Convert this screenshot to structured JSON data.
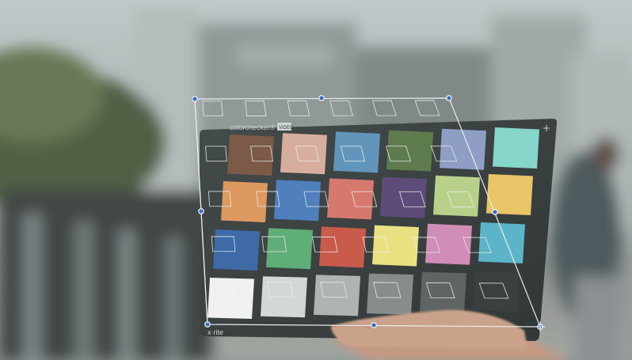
{
  "chart_brand": {
    "name_part1": "colorchecker",
    "name_part2": "®",
    "tag": "VIDEO",
    "maker": "x·rite"
  },
  "patches": [
    {
      "id": "dark-skin",
      "color": "#7b5a47"
    },
    {
      "id": "light-skin",
      "color": "#d7ae9e"
    },
    {
      "id": "blue-sky",
      "color": "#6196ba"
    },
    {
      "id": "foliage",
      "color": "#5d7b4d"
    },
    {
      "id": "blue-flower",
      "color": "#8f9fc4"
    },
    {
      "id": "bluish-green",
      "color": "#86d6cc"
    },
    {
      "id": "orange",
      "color": "#dd995f"
    },
    {
      "id": "purplish-blue",
      "color": "#4f7fbd"
    },
    {
      "id": "moderate-red",
      "color": "#d7786e"
    },
    {
      "id": "purple",
      "color": "#5d4c7a"
    },
    {
      "id": "yellow-green",
      "color": "#b9d08a"
    },
    {
      "id": "orange-yellow",
      "color": "#e8c566"
    },
    {
      "id": "blue",
      "color": "#3e6aa8"
    },
    {
      "id": "green",
      "color": "#5fad77"
    },
    {
      "id": "red",
      "color": "#c95b4a"
    },
    {
      "id": "yellow",
      "color": "#e9e181"
    },
    {
      "id": "magenta",
      "color": "#d08db6"
    },
    {
      "id": "cyan",
      "color": "#5cb4c8"
    },
    {
      "id": "white",
      "color": "#f1f2ef"
    },
    {
      "id": "neutral-8",
      "color": "#d3d8d5"
    },
    {
      "id": "neutral-6-5",
      "color": "#aeb4b2"
    },
    {
      "id": "neutral-5",
      "color": "#878d8c"
    },
    {
      "id": "neutral-3-5",
      "color": "#5f6564"
    },
    {
      "id": "black",
      "color": "#3a3f3f"
    }
  ],
  "colors": {
    "overlay": "#e9ecec",
    "handle": "#3d68c8",
    "board": "#3a4140"
  }
}
